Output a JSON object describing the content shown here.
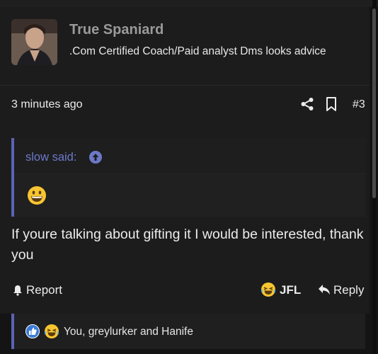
{
  "post": {
    "author_name": "True Spaniard",
    "author_title": ".Com Certified Coach/Paid analyst Dms looks advice",
    "timestamp": "3 minutes ago",
    "post_number": "#3",
    "quote": {
      "author": "slow said:",
      "emoji": "grinning-face"
    },
    "message": "If youre talking about gifting it I would be interested, thank you",
    "actions": {
      "report_label": "Report",
      "reaction_label": "JFL",
      "reply_label": "Reply"
    },
    "reactions": {
      "text": "You, greylurker and Hanife"
    }
  },
  "colors": {
    "accent": "#5a63b6",
    "quote_author": "#6d78c9",
    "background": "#141414",
    "panel": "#1c1c1c"
  },
  "icons": [
    "share-icon",
    "bookmark-icon",
    "arrow-up-circle-icon",
    "grinning-emoji-icon",
    "flag-icon",
    "laughing-emoji-icon",
    "reply-arrow-icon",
    "like-icon"
  ]
}
